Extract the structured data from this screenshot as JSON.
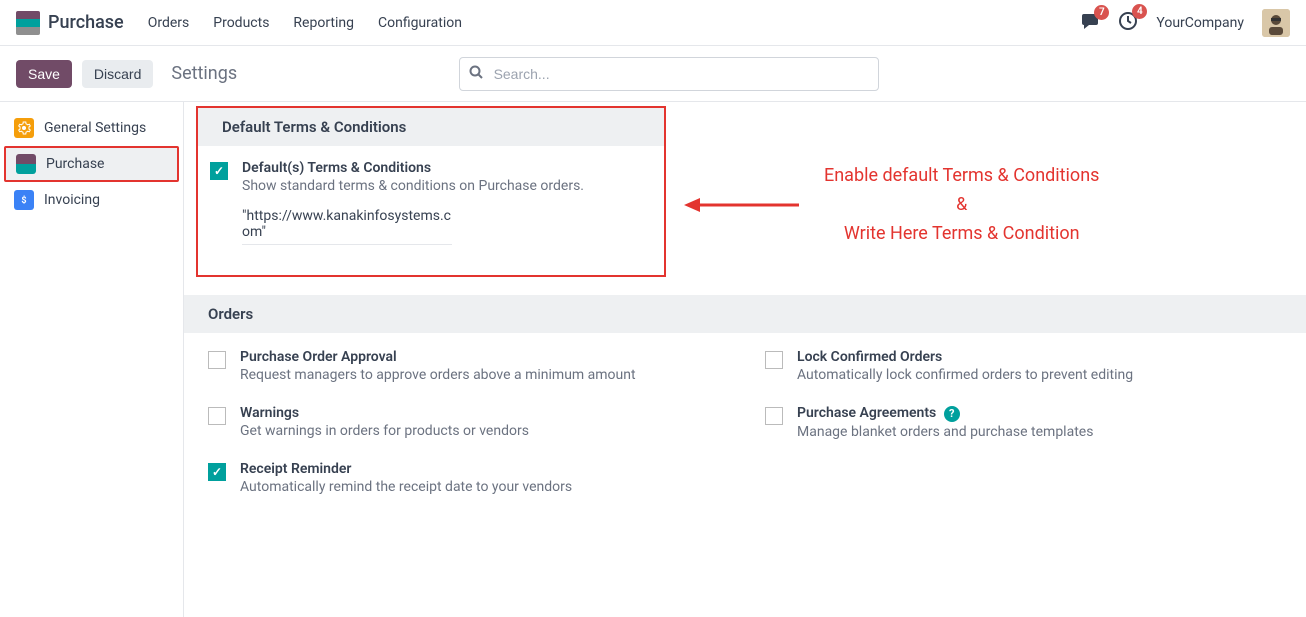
{
  "navbar": {
    "app_name": "Purchase",
    "menu": [
      "Orders",
      "Products",
      "Reporting",
      "Configuration"
    ],
    "chat_badge": "7",
    "activity_badge": "4",
    "company": "YourCompany"
  },
  "control": {
    "save": "Save",
    "discard": "Discard",
    "title": "Settings",
    "search_placeholder": "Search..."
  },
  "sidebar": {
    "items": [
      {
        "label": "General Settings"
      },
      {
        "label": "Purchase"
      },
      {
        "label": "Invoicing"
      }
    ]
  },
  "sections": {
    "terms": {
      "header": "Default Terms & Conditions",
      "item": {
        "title": "Default(s) Terms & Conditions",
        "desc": "Show standard terms & conditions on Purchase orders.",
        "value": "\"https://www.kanakinfosystems.com\""
      }
    },
    "orders": {
      "header": "Orders",
      "left": [
        {
          "title": "Purchase Order Approval",
          "desc": "Request managers to approve orders above a minimum amount",
          "checked": false
        },
        {
          "title": "Warnings",
          "desc": "Get warnings in orders for products or vendors",
          "checked": false
        },
        {
          "title": "Receipt Reminder",
          "desc": "Automatically remind the receipt date to your vendors",
          "checked": true
        }
      ],
      "right": [
        {
          "title": "Lock Confirmed Orders",
          "desc": "Automatically lock confirmed orders to prevent editing",
          "checked": false
        },
        {
          "title": "Purchase Agreements",
          "desc": "Manage blanket orders and purchase templates",
          "checked": false,
          "help": true
        }
      ]
    }
  },
  "annotation": {
    "line1": "Enable default Terms & Conditions",
    "line2": "&",
    "line3": "Write Here Terms & Condition"
  }
}
